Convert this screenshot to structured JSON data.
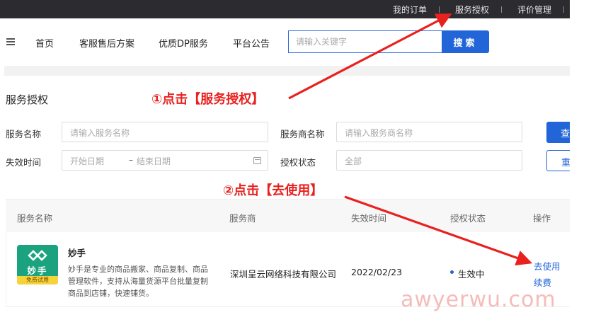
{
  "topbar": {
    "links": [
      {
        "label": "我的订单"
      },
      {
        "label": "服务授权"
      },
      {
        "label": "评价管理"
      }
    ]
  },
  "nav": {
    "items": [
      {
        "label": "首页"
      },
      {
        "label": "客服售后方案"
      },
      {
        "label": "优质DP服务"
      },
      {
        "label": "平台公告"
      }
    ],
    "search_placeholder": "请输入关键字",
    "search_button": "搜索"
  },
  "page_title": "服务授权",
  "filters": {
    "service_name_label": "服务名称",
    "service_name_placeholder": "请输入服务名称",
    "provider_label": "服务商名称",
    "provider_placeholder": "请输入服务商名称",
    "expiry_label": "失效时间",
    "start_placeholder": "开始日期",
    "date_separator": "–",
    "end_placeholder": "结束日期",
    "auth_status_label": "授权状态",
    "auth_status_value": "全部",
    "query_button": "查询",
    "reset_button": "重置"
  },
  "table": {
    "headers": [
      "服务名称",
      "服务商",
      "失效时间",
      "授权状态",
      "操作"
    ],
    "rows": [
      {
        "logo_text": "妙手",
        "logo_tag": "免费试用",
        "name": "妙手",
        "description": "妙手是专业的商品搬家、商品复制、商品管理软件，支持从海量货源平台批量复制商品到店铺，快速铺货。",
        "provider": "深圳呈云网络科技有限公司",
        "expiry": "2022/02/23",
        "status": "生效中",
        "actions": [
          "去使用",
          "续费"
        ]
      }
    ]
  },
  "annotations": {
    "step1": "①点击【服务授权】",
    "step2": "②点击【去使用】",
    "color": "#e8211f"
  },
  "watermark": "awyerwu.com",
  "colors": {
    "primary": "#2165d8",
    "topbar": "#2b2b30",
    "logo_green": "#1aa37e",
    "logo_tag": "#f5d33a"
  }
}
